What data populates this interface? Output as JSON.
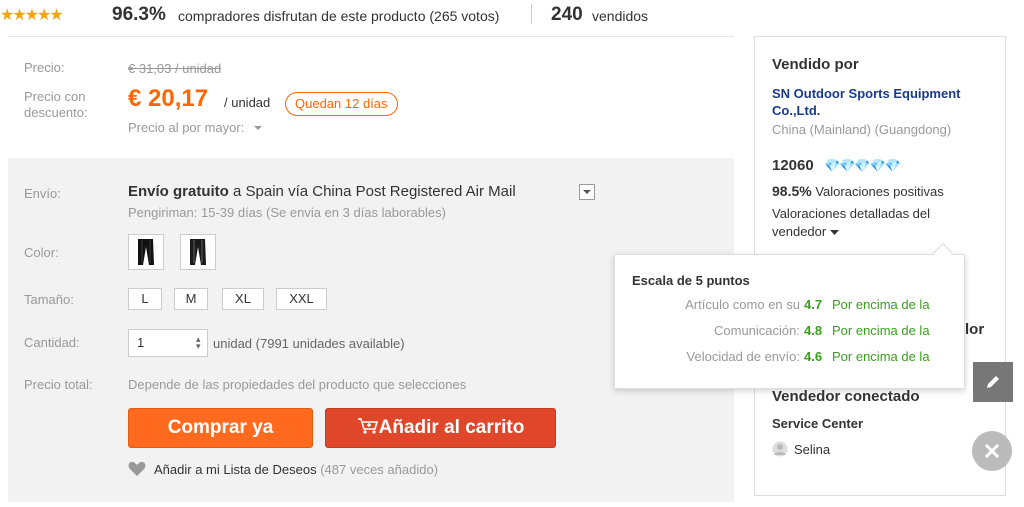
{
  "rating": {
    "stars": "★★★★★",
    "percent": "96.3%",
    "text": "compradores disfrutan de este producto (265 votos)",
    "sold_count": "240",
    "sold_label": "vendidos"
  },
  "price": {
    "label": "Precio:",
    "original": "€ 31,03 / unidad",
    "discount_label_1": "Precio con",
    "discount_label_2": "descuento:",
    "current": "€ 20,17",
    "per_unit": "/ unidad",
    "countdown": "Quedan 12 días",
    "wholesale": "Precio al por mayor:"
  },
  "shipping": {
    "label": "Envío:",
    "free": "Envío gratuito",
    "to": "a",
    "route": "Spain vía China Post Registered Air Mail",
    "estimate": "Pengiriman: 15-39 días (Se envia en 3 días laborables)"
  },
  "color": {
    "label": "Color:"
  },
  "size": {
    "label": "Tamaño:",
    "options": [
      "L",
      "M",
      "XL",
      "XXL"
    ]
  },
  "quantity": {
    "label": "Cantidad:",
    "value": "1",
    "available": "unidad (7991 unidades available)"
  },
  "total": {
    "label": "Precio total:",
    "text": "Depende de las propiedades del producto que selecciones"
  },
  "actions": {
    "buy": "Comprar ya",
    "cart": "Añadir al carrito",
    "wishlist": "Añadir a mi Lista de Deseos",
    "wishlist_count": "(487 veces añadido)"
  },
  "seller": {
    "sold_by": "Vendido por",
    "name_1": "SN Outdoor Sports Equipment",
    "name_2": "Co.,Ltd.",
    "location": "China (Mainland) (Guangdong)",
    "score": "12060",
    "diamonds": "💎💎💎💎💎",
    "positive_pct": "98.5%",
    "positive_label": "Valoraciones positivas",
    "detail_1": "Valoraciones detalladas del",
    "detail_2": "vendedor",
    "hidden_fragment": "lor",
    "connected": "Vendedor conectado",
    "service": "Service Center",
    "agent": "Selina"
  },
  "tooltip": {
    "title": "Escala de 5 puntos",
    "rows": [
      {
        "label": "Artículo como en su",
        "score": "4.7",
        "relation": "Por encima de la"
      },
      {
        "label": "Comunicación:",
        "score": "4.8",
        "relation": "Por encima de la"
      },
      {
        "label": "Velocidad de envío:",
        "score": "4.6",
        "relation": "Por encima de la"
      }
    ]
  },
  "colors": {
    "accent": "#ff6600",
    "buy": "#ff6a1f",
    "cart": "#e0462a",
    "positive": "#3a9e1e",
    "link": "#1a3b8c"
  },
  "icons": [
    "star-icon",
    "dropdown-icon",
    "cart-icon",
    "heart-icon",
    "diamond-icon",
    "avatar-icon",
    "pencil-icon",
    "close-icon"
  ]
}
